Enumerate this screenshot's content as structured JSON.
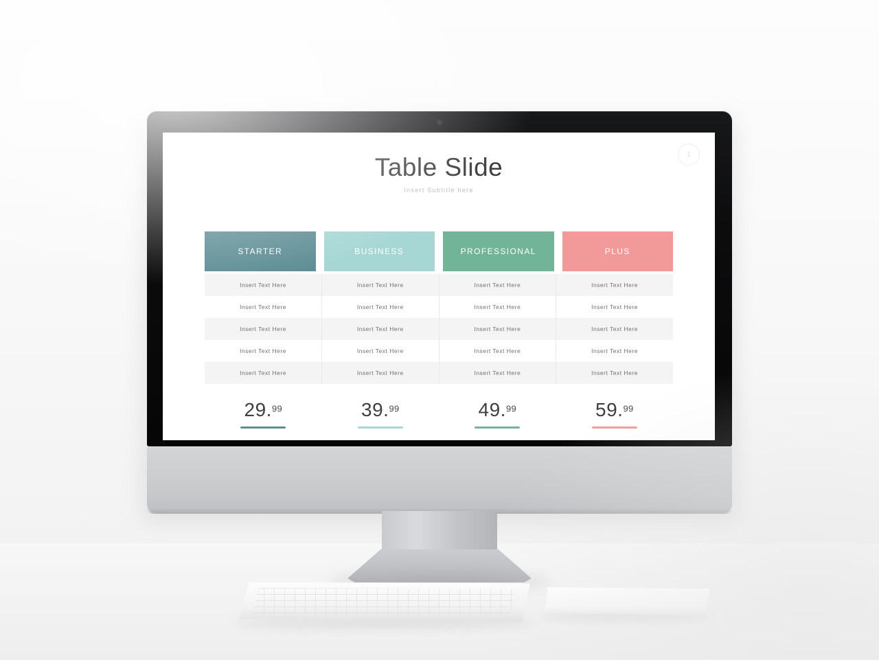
{
  "scene": {
    "device": "desktop-monitor",
    "peripherals": [
      "keyboard",
      "trackpad"
    ]
  },
  "slide": {
    "badge": "1",
    "title": "Table Slide",
    "subtitle": "Insert Subtitle here",
    "columns": [
      {
        "header": "STARTER",
        "color": "#5e8e95",
        "price_main": "29.",
        "price_cents": "99",
        "cells": [
          "Insert  Text Here",
          "Insert  Text Here",
          "Insert  Text Here",
          "Insert  Text Here",
          "Insert  Text Here"
        ]
      },
      {
        "header": "BUSINESS",
        "color": "#a6d7d5",
        "price_main": "39.",
        "price_cents": "99",
        "cells": [
          "Insert  Text Here",
          "Insert  Text Here",
          "Insert  Text Here",
          "Insert  Text Here",
          "Insert  Text Here"
        ]
      },
      {
        "header": "PROFESSIONAL",
        "color": "#71b498",
        "price_main": "49.",
        "price_cents": "99",
        "cells": [
          "Insert  Text Here",
          "Insert  Text Here",
          "Insert  Text Here",
          "Insert  Text Here",
          "Insert  Text Here"
        ]
      },
      {
        "header": "PLUS",
        "color": "#f29a9a",
        "price_main": "59.",
        "price_cents": "99",
        "cells": [
          "Insert  Text Here",
          "Insert  Text Here",
          "Insert  Text Here",
          "Insert  Text Here",
          "Insert  Text Here"
        ]
      }
    ],
    "row_count": 5
  }
}
